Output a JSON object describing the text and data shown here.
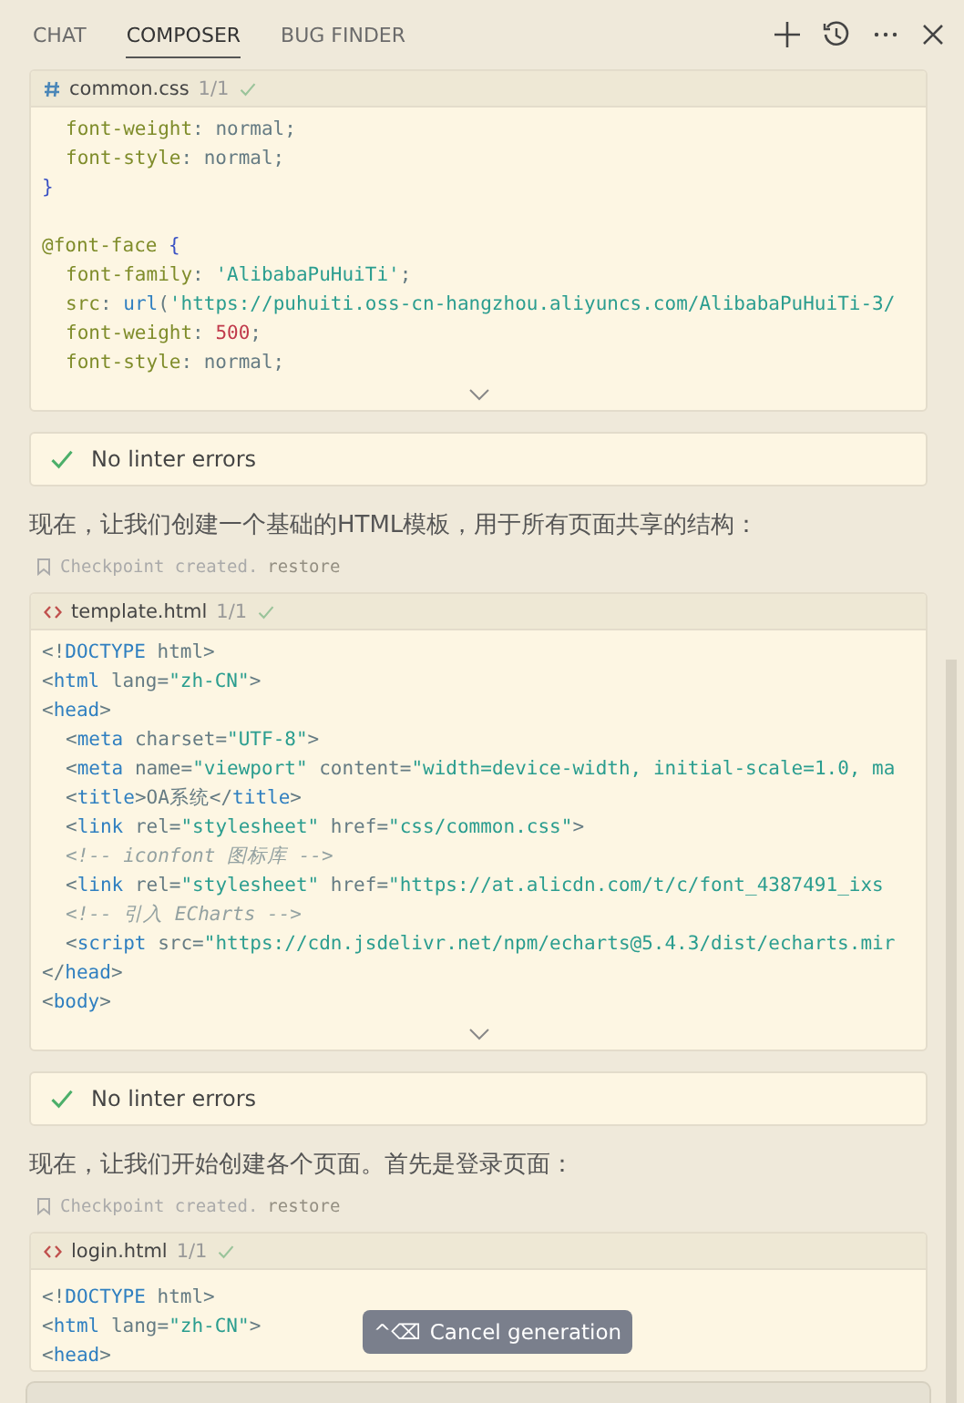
{
  "tabs": [
    {
      "label": "CHAT",
      "selected": false
    },
    {
      "label": "COMPOSER",
      "selected": true
    },
    {
      "label": "BUG FINDER",
      "selected": false
    }
  ],
  "messages": [
    {
      "kind": "code",
      "file": {
        "kind": "css",
        "name": "common.css"
      },
      "count": "1/1",
      "accepted": true,
      "expandable": true,
      "lines": [
        {
          "indented": true,
          "tokens": [
            {
              "kind": "prop",
              "text": "font-weight"
            },
            {
              "kind": "plain",
              "text": ": normal;"
            }
          ]
        },
        {
          "indented": true,
          "tokens": [
            {
              "kind": "prop",
              "text": "font-style"
            },
            {
              "kind": "plain",
              "text": ": normal;"
            }
          ]
        },
        {
          "indented": false,
          "tokens": [
            {
              "kind": "brace",
              "text": "}"
            }
          ]
        },
        {
          "indented": false,
          "blank_before": true,
          "tokens": [
            {
              "kind": "prop",
              "text": "@font-face "
            },
            {
              "kind": "brace",
              "text": "{"
            }
          ]
        },
        {
          "indented": true,
          "tokens": [
            {
              "kind": "prop",
              "text": "font-family"
            },
            {
              "kind": "plain",
              "text": ": "
            },
            {
              "kind": "str",
              "text": "'AlibabaPuHuiTi'"
            },
            {
              "kind": "plain",
              "text": ";"
            }
          ]
        },
        {
          "indented": true,
          "tokens": [
            {
              "kind": "prop",
              "text": "src"
            },
            {
              "kind": "plain",
              "text": ": "
            },
            {
              "kind": "kw",
              "text": "url"
            },
            {
              "kind": "plain",
              "text": "("
            },
            {
              "kind": "str",
              "text": "'https://puhuiti.oss-cn-hangzhou.aliyuncs.com/AlibabaPuHuiTi-3/"
            }
          ]
        },
        {
          "indented": true,
          "tokens": [
            {
              "kind": "prop",
              "text": "font-weight"
            },
            {
              "kind": "plain",
              "text": ": "
            },
            {
              "kind": "num",
              "text": "500"
            },
            {
              "kind": "plain",
              "text": ";"
            }
          ]
        },
        {
          "indented": true,
          "tokens": [
            {
              "kind": "prop",
              "text": "font-style"
            },
            {
              "kind": "plain",
              "text": ": normal;"
            }
          ]
        }
      ]
    },
    {
      "kind": "lint",
      "text": "No linter errors"
    },
    {
      "kind": "text",
      "text": "现在，让我们创建一个基础的HTML模板，用于所有页面共享的结构："
    },
    {
      "kind": "checkpoint",
      "text": "Checkpoint created.",
      "link": "restore"
    },
    {
      "kind": "code",
      "file": {
        "kind": "html",
        "name": "template.html"
      },
      "count": "1/1",
      "accepted": true,
      "expandable": true,
      "lines": [
        {
          "indented": false,
          "tokens": [
            {
              "kind": "plain",
              "text": "<!"
            },
            {
              "kind": "kw",
              "text": "DOCTYPE"
            },
            {
              "kind": "plain",
              "text": " html>"
            }
          ]
        },
        {
          "indented": false,
          "tokens": [
            {
              "kind": "plain",
              "text": "<"
            },
            {
              "kind": "kw",
              "text": "html"
            },
            {
              "kind": "plain",
              "text": " lang="
            },
            {
              "kind": "str",
              "text": "\"zh-CN\""
            },
            {
              "kind": "plain",
              "text": ">"
            }
          ]
        },
        {
          "indented": false,
          "tokens": [
            {
              "kind": "plain",
              "text": "<"
            },
            {
              "kind": "kw",
              "text": "head"
            },
            {
              "kind": "plain",
              "text": ">"
            }
          ]
        },
        {
          "indented": true,
          "tokens": [
            {
              "kind": "plain",
              "text": "<"
            },
            {
              "kind": "kw",
              "text": "meta"
            },
            {
              "kind": "plain",
              "text": " charset="
            },
            {
              "kind": "str",
              "text": "\"UTF-8\""
            },
            {
              "kind": "plain",
              "text": ">"
            }
          ]
        },
        {
          "indented": true,
          "tokens": [
            {
              "kind": "plain",
              "text": "<"
            },
            {
              "kind": "kw",
              "text": "meta"
            },
            {
              "kind": "plain",
              "text": " name="
            },
            {
              "kind": "str",
              "text": "\"viewport\""
            },
            {
              "kind": "plain",
              "text": " content="
            },
            {
              "kind": "str",
              "text": "\"width=device-width, initial-scale=1.0, ma"
            }
          ]
        },
        {
          "indented": true,
          "tokens": [
            {
              "kind": "plain",
              "text": "<"
            },
            {
              "kind": "kw",
              "text": "title"
            },
            {
              "kind": "plain",
              "text": ">OA系统</"
            },
            {
              "kind": "kw",
              "text": "title"
            },
            {
              "kind": "plain",
              "text": ">"
            }
          ]
        },
        {
          "indented": true,
          "tokens": [
            {
              "kind": "plain",
              "text": "<"
            },
            {
              "kind": "kw",
              "text": "link"
            },
            {
              "kind": "plain",
              "text": " rel="
            },
            {
              "kind": "str",
              "text": "\"stylesheet\""
            },
            {
              "kind": "plain",
              "text": " href="
            },
            {
              "kind": "str",
              "text": "\"css/common.css\""
            },
            {
              "kind": "plain",
              "text": ">"
            }
          ]
        },
        {
          "indented": true,
          "tokens": [
            {
              "kind": "comment",
              "text": "<!-- iconfont 图标库 -->"
            }
          ]
        },
        {
          "indented": true,
          "tokens": [
            {
              "kind": "plain",
              "text": "<"
            },
            {
              "kind": "kw",
              "text": "link"
            },
            {
              "kind": "plain",
              "text": " rel="
            },
            {
              "kind": "str",
              "text": "\"stylesheet\""
            },
            {
              "kind": "plain",
              "text": " href="
            },
            {
              "kind": "str",
              "text": "\"https://at.alicdn.com/t/c/font_4387491_ixs"
            }
          ]
        },
        {
          "indented": true,
          "tokens": [
            {
              "kind": "comment",
              "text": "<!-- 引入 ECharts -->"
            }
          ]
        },
        {
          "indented": true,
          "tokens": [
            {
              "kind": "plain",
              "text": "<"
            },
            {
              "kind": "kw",
              "text": "script"
            },
            {
              "kind": "plain",
              "text": " src="
            },
            {
              "kind": "str",
              "text": "\"https://cdn.jsdelivr.net/npm/echarts@5.4.3/dist/echarts.mir"
            }
          ]
        },
        {
          "indented": false,
          "tokens": [
            {
              "kind": "plain",
              "text": "</"
            },
            {
              "kind": "kw",
              "text": "head"
            },
            {
              "kind": "plain",
              "text": ">"
            }
          ]
        },
        {
          "indented": false,
          "tokens": [
            {
              "kind": "plain",
              "text": "<"
            },
            {
              "kind": "kw",
              "text": "body"
            },
            {
              "kind": "plain",
              "text": ">"
            }
          ]
        }
      ]
    },
    {
      "kind": "lint",
      "text": "No linter errors"
    },
    {
      "kind": "text",
      "text": "现在，让我们开始创建各个页面。首先是登录页面："
    },
    {
      "kind": "checkpoint",
      "text": "Checkpoint created.",
      "link": "restore"
    },
    {
      "kind": "code",
      "file": {
        "kind": "html",
        "name": "login.html"
      },
      "count": "1/1",
      "accepted": true,
      "expandable": false,
      "lines": [
        {
          "indented": false,
          "tokens": [
            {
              "kind": "plain",
              "text": "<!"
            },
            {
              "kind": "kw",
              "text": "DOCTYPE"
            },
            {
              "kind": "plain",
              "text": " html>"
            }
          ]
        },
        {
          "indented": false,
          "tokens": [
            {
              "kind": "plain",
              "text": "<"
            },
            {
              "kind": "kw",
              "text": "html"
            },
            {
              "kind": "plain",
              "text": " lang="
            },
            {
              "kind": "str",
              "text": "\"zh-CN\""
            },
            {
              "kind": "plain",
              "text": ">"
            }
          ]
        },
        {
          "indented": false,
          "tokens": [
            {
              "kind": "plain",
              "text": "<"
            },
            {
              "kind": "kw",
              "text": "head"
            },
            {
              "kind": "plain",
              "text": ">"
            }
          ]
        }
      ]
    }
  ],
  "cancel_button": {
    "shortcut": "^⌫",
    "label": "Cancel generation"
  }
}
